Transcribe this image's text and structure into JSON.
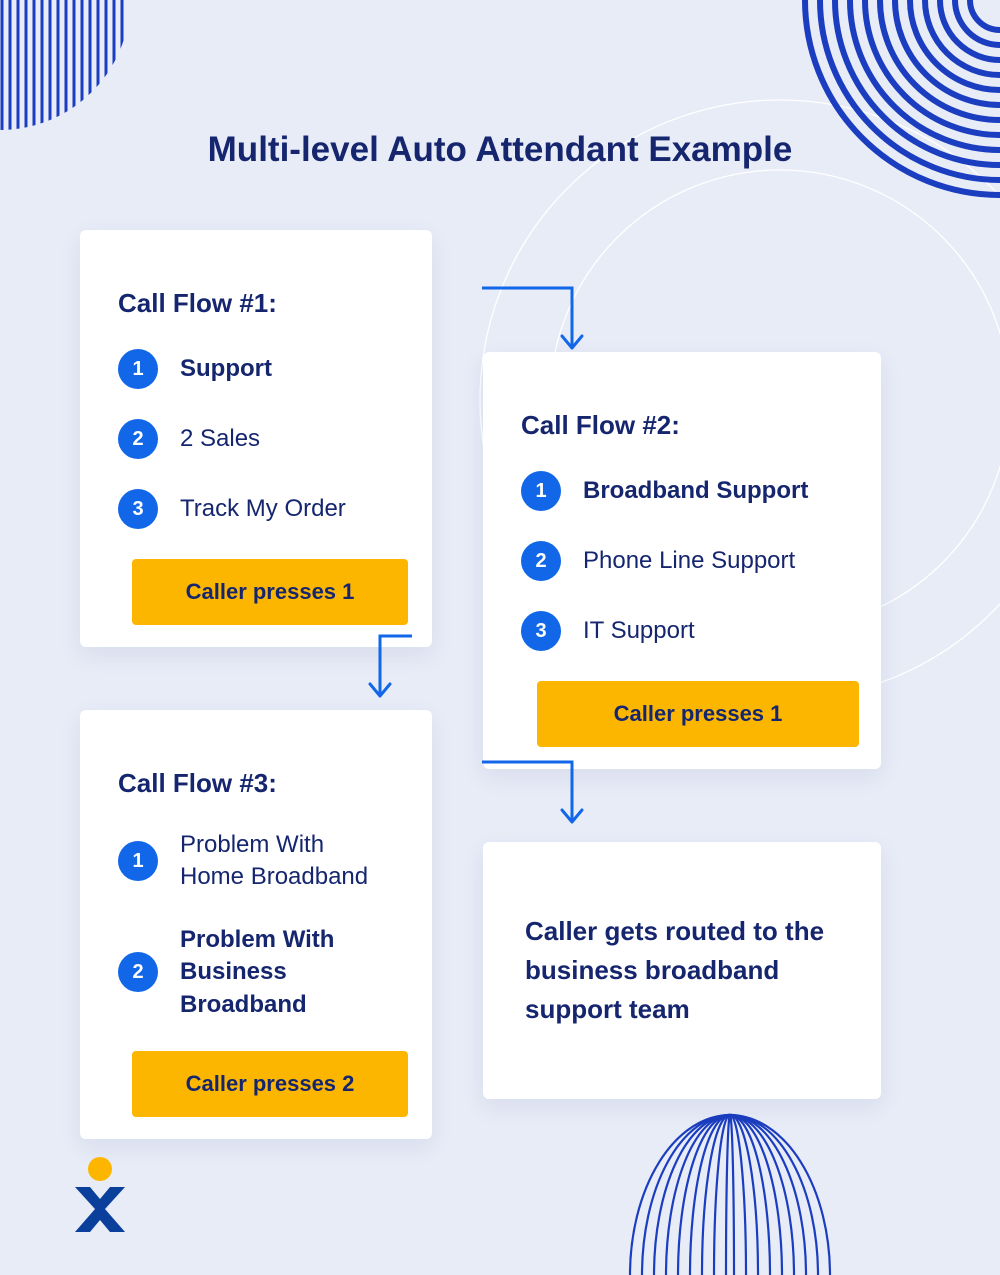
{
  "title": "Multi-level Auto Attendant Example",
  "cards": {
    "c1": {
      "heading": "Call Flow #1:",
      "options": [
        {
          "num": "1",
          "label": "Support",
          "bold": true
        },
        {
          "num": "2",
          "label": "2 Sales",
          "bold": false
        },
        {
          "num": "3",
          "label": "Track My Order",
          "bold": false
        }
      ],
      "cta": "Caller presses 1"
    },
    "c2": {
      "heading": "Call Flow #2:",
      "options": [
        {
          "num": "1",
          "label": "Broadband Support",
          "bold": true
        },
        {
          "num": "2",
          "label": "Phone Line Support",
          "bold": false
        },
        {
          "num": "3",
          "label": "IT Support",
          "bold": false
        }
      ],
      "cta": "Caller presses 1"
    },
    "c3": {
      "heading": "Call Flow #3:",
      "options": [
        {
          "num": "1",
          "label": "Problem With Home Broadband",
          "bold": false
        },
        {
          "num": "2",
          "label": "Problem With Business Broadband",
          "bold": true
        }
      ],
      "cta": "Caller presses 2"
    },
    "c4": {
      "text": "Caller gets routed to the business broadband support team"
    }
  }
}
